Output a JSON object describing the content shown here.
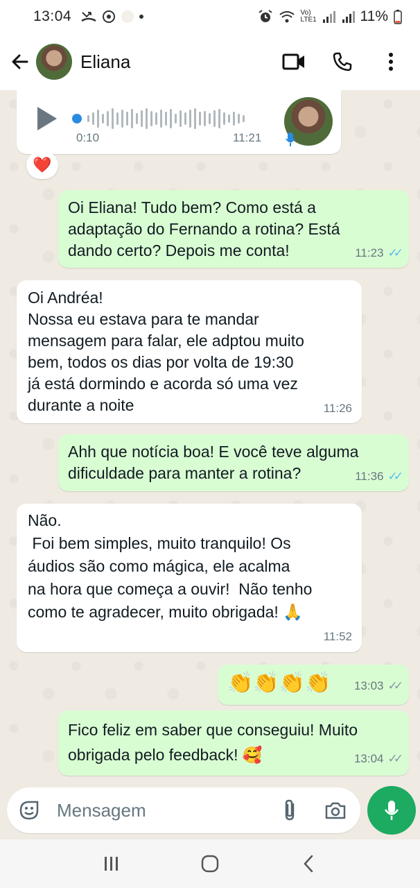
{
  "status_bar": {
    "time": "13:04",
    "battery": "11%",
    "network_label": "Vo) LTE1"
  },
  "header": {
    "contact_name": "Eliana",
    "icons": [
      "back-arrow-icon",
      "video-call-icon",
      "phone-icon",
      "more-vert-icon"
    ]
  },
  "voice_message": {
    "duration": "0:10",
    "time": "11:21",
    "reaction": "❤️"
  },
  "messages": [
    {
      "direction": "out",
      "text": "Oi Eliana! Tudo bem? Como está a\nadaptação do Fernando a rotina? Está\ndando certo? Depois me conta!",
      "time": "11:23",
      "status": "read"
    },
    {
      "direction": "in",
      "text": "Oi Andréa!\nNossa eu estava para te mandar\nmensagem para falar, ele adptou muito\nbem, todos os dias por volta de 19:30\njá está dormindo e acorda só uma vez\ndurante a noite",
      "time": "11:26"
    },
    {
      "direction": "out",
      "text": "Ahh que notícia boa! E você teve alguma\ndificuldade para manter a rotina?",
      "time": "11:36",
      "status": "read"
    },
    {
      "direction": "in",
      "text": "Não.\n Foi bem simples, muito tranquilo! Os\náudios são como mágica, ele acalma\nna hora que começa a ouvir!  Não tenho\ncomo te agradecer, muito obrigada! 🙏",
      "time": "11:52"
    },
    {
      "direction": "out",
      "text": "👏👏👏👏",
      "time": "13:03",
      "status": "delivered"
    },
    {
      "direction": "out",
      "text": "Fico feliz em saber que conseguiu! Muito\nobrigada pelo feedback! 🥰",
      "time": "13:04",
      "status": "delivered"
    }
  ],
  "ticks_symbol": "✓✓",
  "input": {
    "placeholder": "Mensagem"
  },
  "colors": {
    "outgoing_bubble": "#d9fdd3",
    "incoming_bubble": "#ffffff",
    "accent_green": "#1daa61",
    "read_ticks": "#53bdeb"
  }
}
